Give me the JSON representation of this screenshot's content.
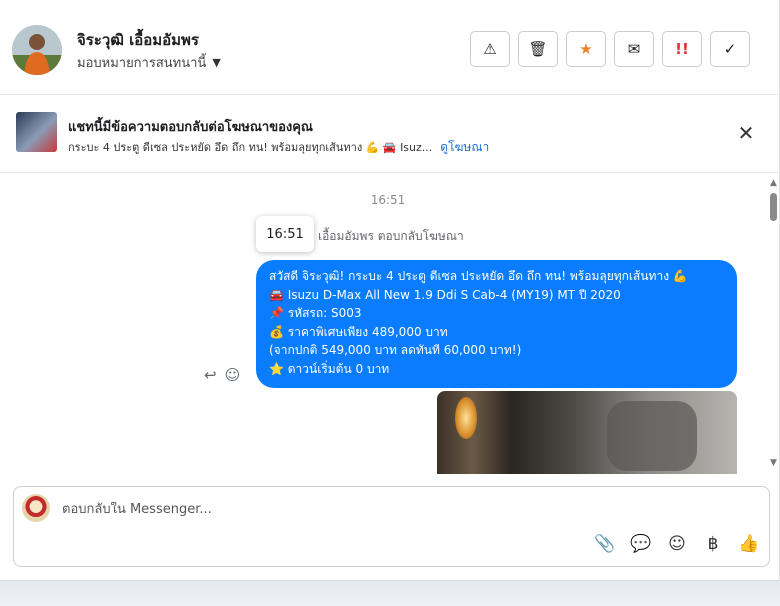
{
  "header": {
    "name": "จิระวุฒิ เอื้อมอัมพร",
    "assign_label": "มอบหมายการสนทนานี้",
    "assign_caret": "▼",
    "actions": [
      {
        "name": "alert",
        "glyph": "⚠"
      },
      {
        "name": "trash",
        "glyph": "🗑"
      },
      {
        "name": "star",
        "glyph": "★"
      },
      {
        "name": "mail",
        "glyph": "✉"
      },
      {
        "name": "priority",
        "glyph": "!!"
      },
      {
        "name": "done",
        "glyph": "✓"
      }
    ]
  },
  "ad": {
    "title": "แชทนี้มีข้อความตอบกลับต่อโฆษณาของคุณ",
    "subtitle": "กระบะ 4 ประตู ดีเซล ประหยัด อึด ถึก ทน! พร้อมลุยทุกเส้นทาง 💪 🚘 Isuz...",
    "link": "ดูโฆษณา",
    "close": "✕"
  },
  "conversation": {
    "timestamp": "16:51",
    "tooltip_time": "16:51",
    "reply_note": "เอื้อมอัมพร ตอบกลับโฆษณา",
    "message_lines": [
      "สวัสดี จิระวุฒิ! กระบะ 4 ประตู ดีเซล ประหยัด อึด ถึก ทน! พร้อมลุยทุกเส้นทาง 💪",
      "🚘 Isuzu D-Max All New 1.9 Ddi S Cab-4 (MY19) MT ปี 2020",
      "📌 รหัสรถ: S003",
      "💰 ราคาพิเศษเพียง 489,000 บาท",
      "(จากปกติ 549,000 บาท ลดทันที 60,000 บาท!)",
      "⭐ ดาวน์เริ่มต้น 0 บาท"
    ],
    "tools": {
      "reply": "↩",
      "react": "☺"
    }
  },
  "scrollbar": {
    "up": "▲",
    "down": "▼"
  },
  "composer": {
    "placeholder": "ตอบกลับใน Messenger...",
    "tools": {
      "attach": "📎",
      "saved_reply": "💬",
      "emoji": "☺",
      "payment": "฿",
      "like": "👍"
    }
  }
}
